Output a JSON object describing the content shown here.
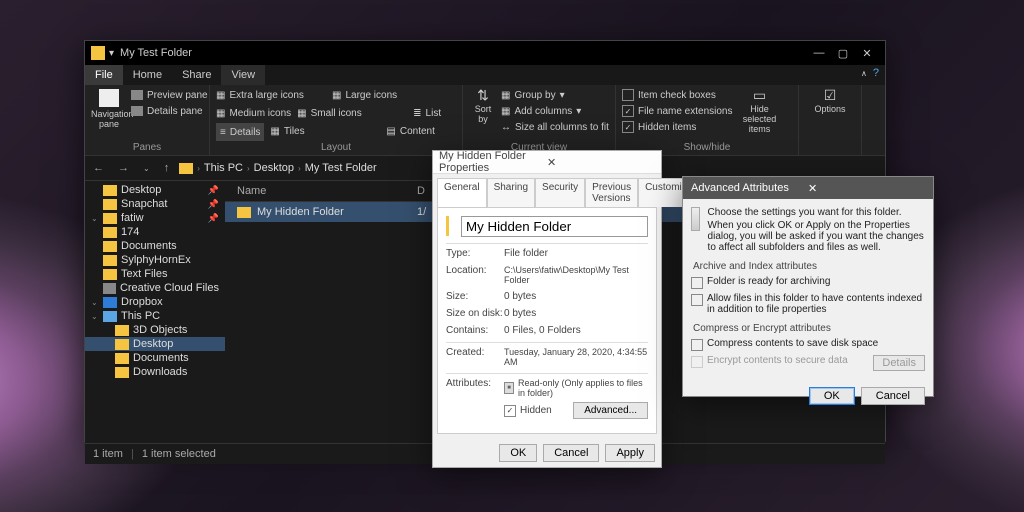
{
  "explorer": {
    "title": "My Test Folder",
    "menu": {
      "file": "File",
      "home": "Home",
      "share": "Share",
      "view": "View"
    },
    "ribbon": {
      "panes": {
        "nav": "Navigation pane",
        "preview": "Preview pane",
        "details": "Details pane",
        "group": "Panes"
      },
      "layout": {
        "xl": "Extra large icons",
        "l": "Large icons",
        "m": "Medium icons",
        "s": "Small icons",
        "list": "List",
        "details": "Details",
        "tiles": "Tiles",
        "content": "Content",
        "group": "Layout"
      },
      "current": {
        "sort": "Sort by",
        "groupby": "Group by",
        "addcols": "Add columns",
        "sizeall": "Size all columns to fit",
        "group": "Current view"
      },
      "showhide": {
        "itemchk": "Item check boxes",
        "ext": "File name extensions",
        "hidden": "Hidden items",
        "hidebtn": "Hide selected items",
        "group": "Show/hide"
      },
      "options": "Options"
    },
    "breadcrumb": [
      "This PC",
      "Desktop",
      "My Test Folder"
    ],
    "tree": [
      {
        "name": "Desktop",
        "pin": true
      },
      {
        "name": "Snapchat",
        "pin": true
      },
      {
        "name": "fatiw",
        "pin": true,
        "exp": true
      },
      {
        "name": "174"
      },
      {
        "name": "Documents"
      },
      {
        "name": "SylphyHornEx"
      },
      {
        "name": "Text Files"
      },
      {
        "name": "Creative Cloud Files",
        "ico": "grey"
      },
      {
        "name": "Dropbox",
        "ico": "db",
        "exp": true
      },
      {
        "name": "This PC",
        "ico": "blue",
        "exp": true
      },
      {
        "name": "3D Objects",
        "indent": true
      },
      {
        "name": "Desktop",
        "indent": true,
        "sel": true
      },
      {
        "name": "Documents",
        "indent": true
      },
      {
        "name": "Downloads",
        "indent": true,
        "cut": true
      }
    ],
    "list": {
      "hdr": {
        "name": "Name",
        "date": "D"
      },
      "rows": [
        {
          "name": "My Hidden Folder",
          "date": "1/"
        }
      ]
    },
    "status": {
      "count": "1 item",
      "sel": "1 item selected"
    }
  },
  "props": {
    "title": "My Hidden Folder Properties",
    "tabs": [
      "General",
      "Sharing",
      "Security",
      "Previous Versions",
      "Customize"
    ],
    "name": "My Hidden Folder",
    "fields": {
      "type_l": "Type:",
      "type": "File folder",
      "loc_l": "Location:",
      "loc": "C:\\Users\\fatiw\\Desktop\\My Test Folder",
      "size_l": "Size:",
      "size": "0 bytes",
      "sod_l": "Size on disk:",
      "sod": "0 bytes",
      "cont_l": "Contains:",
      "cont": "0 Files, 0 Folders",
      "created_l": "Created:",
      "created": "Tuesday, January 28, 2020, 4:34:55 AM",
      "attr_l": "Attributes:"
    },
    "attrs": {
      "readonly": "Read-only (Only applies to files in folder)",
      "hidden": "Hidden",
      "advanced": "Advanced..."
    },
    "buttons": {
      "ok": "OK",
      "cancel": "Cancel",
      "apply": "Apply"
    }
  },
  "adv": {
    "title": "Advanced Attributes",
    "intro1": "Choose the settings you want for this folder.",
    "intro2": "When you click OK or Apply on the Properties dialog, you will be asked if you want the changes to affect all subfolders and files as well.",
    "archive_legend": "Archive and Index attributes",
    "archive": "Folder is ready for archiving",
    "index": "Allow files in this folder to have contents indexed in addition to file properties",
    "compress_legend": "Compress or Encrypt attributes",
    "compress": "Compress contents to save disk space",
    "encrypt": "Encrypt contents to secure data",
    "details": "Details",
    "ok": "OK",
    "cancel": "Cancel"
  }
}
